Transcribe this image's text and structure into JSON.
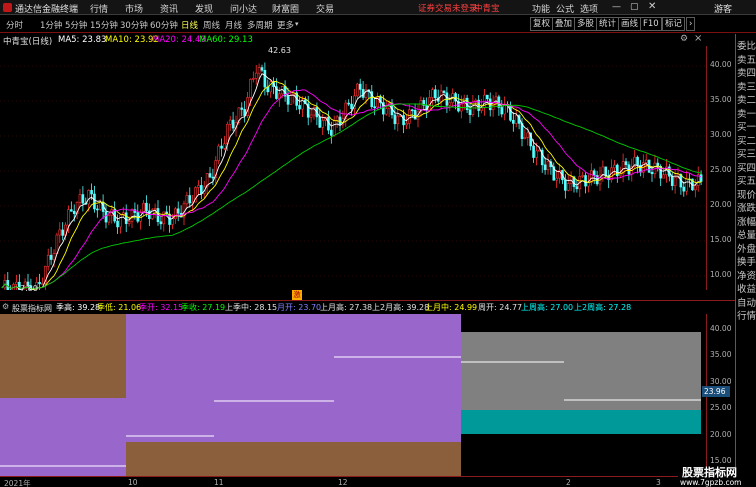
{
  "app": {
    "title": "通达信金融终端",
    "menu": [
      "行情",
      "市场",
      "资讯",
      "发现",
      "问小达",
      "财富圈",
      "交易"
    ],
    "login_status": "证券交易未登录",
    "stock_name": "中青宝",
    "right_menu": [
      "功能",
      "公式",
      "选项"
    ],
    "guest": "游客"
  },
  "toolbar": {
    "period_tabs": [
      "分时",
      "1分钟",
      "5分钟",
      "15分钟",
      "30分钟",
      "60分钟",
      "日线",
      "周线",
      "月线",
      "多周期",
      "更多"
    ],
    "active_tab": "日线",
    "buttons": [
      "复权",
      "叠加",
      "多股",
      "统计",
      "画线",
      "F10",
      "标记"
    ]
  },
  "main_chart": {
    "title": "中青宝(日线)",
    "ma": [
      {
        "label": "MA5: 23.83",
        "color": "#ffffff"
      },
      {
        "label": "MA10: 23.92",
        "color": "#ffff00"
      },
      {
        "label": "MA20: 24.49",
        "color": "#ff00ff"
      },
      {
        "label": "MA60: 29.13",
        "color": "#00ff00"
      }
    ],
    "high_label": "42.63",
    "low_label": "7.80",
    "marker": "激",
    "price_axis": [
      "40.00",
      "35.00",
      "30.00",
      "25.00",
      "20.00",
      "15.00",
      "10.00"
    ]
  },
  "indicator": {
    "title": "股票指标网",
    "items": [
      {
        "label": "季高: 39.28",
        "color": "#ffffff"
      },
      {
        "label": "季低: 21.06",
        "color": "#ffff00"
      },
      {
        "label": "季开: 32.15",
        "color": "#ff00ff"
      },
      {
        "label": "季收: 27.19",
        "color": "#00ff00"
      },
      {
        "label": "上季中: 28.15",
        "color": "#e0e0e0"
      },
      {
        "label": "月开: 23.70",
        "color": "#8080ff"
      },
      {
        "label": "上月高: 27.38",
        "color": "#e0e0e0"
      },
      {
        "label": "上2月高: 39.28",
        "color": "#e0e0e0"
      },
      {
        "label": "上月中: 24.99",
        "color": "#ffff00"
      },
      {
        "label": "周开: 24.77",
        "color": "#e0e0e0"
      },
      {
        "label": "上周高: 27.00",
        "color": "#00ffff"
      },
      {
        "label": "上2周高: 27.28",
        "color": "#00ffff"
      }
    ],
    "axis": [
      "40.00",
      "35.00",
      "30.00",
      "25.00",
      "20.00",
      "15.00"
    ],
    "current_value": "23.96"
  },
  "date_axis": [
    "2021年",
    "10",
    "11",
    "12",
    "2",
    "3"
  ],
  "sidebar": [
    "委比",
    "卖五",
    "卖四",
    "卖三",
    "卖二",
    "卖一",
    "买一",
    "买二",
    "买三",
    "买四",
    "买五",
    "现价",
    "涨跌",
    "涨幅",
    "总量",
    "外盘",
    "换手",
    "净资",
    "收益",
    "自动",
    "行情"
  ],
  "watermark": {
    "cn": "股票指标网",
    "url": "www.7gpzb.com"
  }
}
